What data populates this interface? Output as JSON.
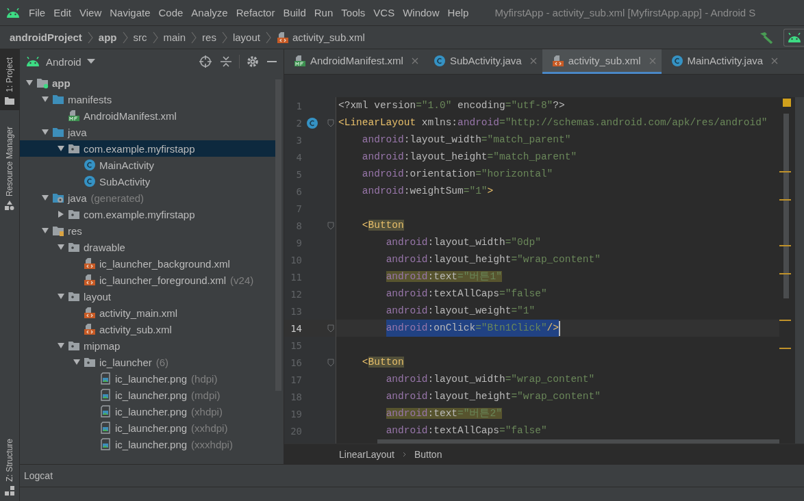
{
  "menu": [
    "File",
    "Edit",
    "View",
    "Navigate",
    "Code",
    "Analyze",
    "Refactor",
    "Build",
    "Run",
    "Tools",
    "VCS",
    "Window",
    "Help"
  ],
  "window": {
    "title": "MyfirstApp - activity_sub.xml [MyfirstApp.app] - Android S"
  },
  "breadcrumbs": [
    {
      "label": "androidProject",
      "bold": true,
      "kind": "dir"
    },
    {
      "label": "app",
      "bold": true,
      "kind": "dir"
    },
    {
      "label": "src",
      "bold": false,
      "kind": "dir"
    },
    {
      "label": "main",
      "bold": false,
      "kind": "dir"
    },
    {
      "label": "res",
      "bold": false,
      "kind": "dir"
    },
    {
      "label": "layout",
      "bold": false,
      "kind": "dir"
    },
    {
      "label": "activity_sub.xml",
      "bold": false,
      "kind": "file"
    }
  ],
  "left_strip": [
    {
      "label": "1: Project",
      "selected": true
    },
    {
      "label": "Resource Manager",
      "selected": false
    },
    {
      "label": "Z: Structure",
      "selected": false
    }
  ],
  "project_panel": {
    "view": "Android",
    "tree": [
      {
        "label": "app",
        "kind": "module",
        "bold": true,
        "expanded": true,
        "selected": false,
        "children": [
          {
            "label": "manifests",
            "kind": "folder",
            "bold": false,
            "expanded": true,
            "selected": false,
            "children": [
              {
                "label": "AndroidManifest.xml",
                "kind": "manifest",
                "bold": false,
                "selected": false
              }
            ]
          },
          {
            "label": "java",
            "kind": "folder",
            "bold": false,
            "expanded": true,
            "selected": false,
            "children": [
              {
                "label": "com.example.myfirstapp",
                "kind": "package",
                "bold": false,
                "expanded": true,
                "selected": true,
                "children": [
                  {
                    "label": "MainActivity",
                    "kind": "class",
                    "bold": false,
                    "selected": false
                  },
                  {
                    "label": "SubActivity",
                    "kind": "class",
                    "bold": false,
                    "selected": false
                  }
                ]
              }
            ]
          },
          {
            "label": "java",
            "note": "(generated)",
            "kind": "generated",
            "bold": false,
            "expanded": true,
            "selected": false,
            "children": [
              {
                "label": "com.example.myfirstapp",
                "kind": "package",
                "bold": false,
                "expanded": false,
                "selected": false
              }
            ]
          },
          {
            "label": "res",
            "kind": "res",
            "bold": false,
            "expanded": true,
            "selected": false,
            "children": [
              {
                "label": "drawable",
                "kind": "package",
                "bold": false,
                "expanded": true,
                "selected": false,
                "children": [
                  {
                    "label": "ic_launcher_background.xml",
                    "kind": "xml",
                    "bold": false,
                    "selected": false
                  },
                  {
                    "label": "ic_launcher_foreground.xml",
                    "note": "(v24)",
                    "kind": "xml",
                    "bold": false,
                    "selected": false
                  }
                ]
              },
              {
                "label": "layout",
                "kind": "package",
                "bold": false,
                "expanded": true,
                "selected": false,
                "children": [
                  {
                    "label": "activity_main.xml",
                    "kind": "xml",
                    "bold": false,
                    "selected": false
                  },
                  {
                    "label": "activity_sub.xml",
                    "kind": "xml",
                    "bold": false,
                    "selected": false
                  }
                ]
              },
              {
                "label": "mipmap",
                "kind": "package",
                "bold": false,
                "expanded": true,
                "selected": false,
                "children": [
                  {
                    "label": "ic_launcher",
                    "note": "(6)",
                    "kind": "package",
                    "bold": false,
                    "expanded": true,
                    "selected": false,
                    "children": [
                      {
                        "label": "ic_launcher.png",
                        "note": "(hdpi)",
                        "kind": "image",
                        "bold": false,
                        "selected": false
                      },
                      {
                        "label": "ic_launcher.png",
                        "note": "(mdpi)",
                        "kind": "image",
                        "bold": false,
                        "selected": false
                      },
                      {
                        "label": "ic_launcher.png",
                        "note": "(xhdpi)",
                        "kind": "image",
                        "bold": false,
                        "selected": false
                      },
                      {
                        "label": "ic_launcher.png",
                        "note": "(xxhdpi)",
                        "kind": "image",
                        "bold": false,
                        "selected": false
                      },
                      {
                        "label": "ic_launcher.png",
                        "note": "(xxxhdpi)",
                        "kind": "image",
                        "bold": false,
                        "selected": false
                      }
                    ]
                  }
                ]
              }
            ]
          }
        ]
      }
    ]
  },
  "tabs": [
    {
      "label": "AndroidManifest.xml",
      "kind": "manifest",
      "selected": false
    },
    {
      "label": "SubActivity.java",
      "kind": "class",
      "selected": false
    },
    {
      "label": "activity_sub.xml",
      "kind": "xml",
      "selected": true
    },
    {
      "label": "MainActivity.java",
      "kind": "class",
      "selected": false
    }
  ],
  "code": [
    {
      "number": "1",
      "current": false,
      "fold": false,
      "gutter_marker": false,
      "warning": false,
      "selected": false,
      "tokens": [
        {
          "text": "<?xml ",
          "kind": "plain"
        },
        {
          "text": "version",
          "kind": "attr"
        },
        {
          "text": "=\"1.0\" ",
          "kind": "value"
        },
        {
          "text": "encoding",
          "kind": "attr"
        },
        {
          "text": "=\"utf-8\"",
          "kind": "value"
        },
        {
          "text": "?>",
          "kind": "plain"
        }
      ]
    },
    {
      "number": "2",
      "current": false,
      "fold": true,
      "gutter_marker": true,
      "warning": false,
      "selected": false,
      "tokens": [
        {
          "text": "<LinearLayout ",
          "kind": "tag"
        },
        {
          "text": "xmlns:",
          "kind": "attr"
        },
        {
          "text": "android",
          "kind": "ns"
        },
        {
          "text": "=\"http://schemas.android.com/apk/res/android\"",
          "kind": "value"
        }
      ]
    },
    {
      "number": "3",
      "current": false,
      "fold": false,
      "gutter_marker": false,
      "warning": false,
      "selected": false,
      "tokens": [
        {
          "text": "    android",
          "kind": "ns"
        },
        {
          "text": ":layout_width",
          "kind": "attr"
        },
        {
          "text": "=\"match_parent\"",
          "kind": "value"
        }
      ]
    },
    {
      "number": "4",
      "current": false,
      "fold": false,
      "gutter_marker": false,
      "warning": false,
      "selected": false,
      "tokens": [
        {
          "text": "    android",
          "kind": "ns"
        },
        {
          "text": ":layout_height",
          "kind": "attr"
        },
        {
          "text": "=\"match_parent\"",
          "kind": "value"
        }
      ]
    },
    {
      "number": "5",
      "current": false,
      "fold": false,
      "gutter_marker": false,
      "warning": false,
      "selected": false,
      "tokens": [
        {
          "text": "    android",
          "kind": "ns"
        },
        {
          "text": ":orientation",
          "kind": "attr"
        },
        {
          "text": "=\"horizontal\"",
          "kind": "value"
        }
      ]
    },
    {
      "number": "6",
      "current": false,
      "fold": false,
      "gutter_marker": false,
      "warning": false,
      "selected": false,
      "tokens": [
        {
          "text": "    android",
          "kind": "ns"
        },
        {
          "text": ":weightSum",
          "kind": "attr"
        },
        {
          "text": "=\"1\"",
          "kind": "value"
        },
        {
          "text": ">",
          "kind": "tag"
        }
      ]
    },
    {
      "number": "7",
      "current": false,
      "fold": false,
      "gutter_marker": false
    },
    {
      "number": "8",
      "current": false,
      "fold": true,
      "gutter_marker": false,
      "warning": false,
      "selected": false,
      "tokens": [
        {
          "text": "    <",
          "kind": "tag"
        },
        {
          "text": "Button",
          "kind": "matched"
        }
      ]
    },
    {
      "number": "9",
      "current": false,
      "fold": false,
      "gutter_marker": false,
      "warning": false,
      "selected": false,
      "tokens": [
        {
          "text": "        android",
          "kind": "ns"
        },
        {
          "text": ":layout_width",
          "kind": "attr"
        },
        {
          "text": "=\"0dp\"",
          "kind": "value"
        }
      ]
    },
    {
      "number": "10",
      "current": false,
      "fold": false,
      "gutter_marker": false,
      "warning": false,
      "selected": false,
      "tokens": [
        {
          "text": "        android",
          "kind": "ns"
        },
        {
          "text": ":layout_height",
          "kind": "attr"
        },
        {
          "text": "=\"wrap_content\"",
          "kind": "value"
        }
      ]
    },
    {
      "number": "11",
      "current": false,
      "fold": false,
      "gutter_marker": false,
      "warning": true,
      "selected": false,
      "tokens": [
        {
          "text": "        android",
          "kind": "ns"
        },
        {
          "text": ":text",
          "kind": "attr"
        },
        {
          "text": "=\"버튼1\"",
          "kind": "value"
        }
      ]
    },
    {
      "number": "12",
      "current": false,
      "fold": false,
      "gutter_marker": false,
      "warning": false,
      "selected": false,
      "tokens": [
        {
          "text": "        android",
          "kind": "ns"
        },
        {
          "text": ":textAllCaps",
          "kind": "attr"
        },
        {
          "text": "=\"false\"",
          "kind": "value"
        }
      ]
    },
    {
      "number": "13",
      "current": false,
      "fold": false,
      "gutter_marker": false,
      "warning": false,
      "selected": false,
      "tokens": [
        {
          "text": "        android",
          "kind": "ns"
        },
        {
          "text": ":layout_weight",
          "kind": "attr"
        },
        {
          "text": "=\"1\"",
          "kind": "value"
        }
      ]
    },
    {
      "number": "14",
      "current": true,
      "fold": true,
      "gutter_marker": false,
      "warning": false,
      "selected": true,
      "tokens": [
        {
          "text": "        android",
          "kind": "ns"
        },
        {
          "text": ":onClick",
          "kind": "attr"
        },
        {
          "text": "=\"Btn1Click\"",
          "kind": "value"
        },
        {
          "text": "/>",
          "kind": "tag"
        }
      ]
    },
    {
      "number": "15",
      "current": false,
      "fold": false,
      "gutter_marker": false
    },
    {
      "number": "16",
      "current": false,
      "fold": true,
      "gutter_marker": false,
      "warning": false,
      "selected": false,
      "tokens": [
        {
          "text": "    <",
          "kind": "tag"
        },
        {
          "text": "Button",
          "kind": "matched"
        }
      ]
    },
    {
      "number": "17",
      "current": false,
      "fold": false,
      "gutter_marker": false,
      "warning": false,
      "selected": false,
      "tokens": [
        {
          "text": "        android",
          "kind": "ns"
        },
        {
          "text": ":layout_width",
          "kind": "attr"
        },
        {
          "text": "=\"wrap_content\"",
          "kind": "value"
        }
      ]
    },
    {
      "number": "18",
      "current": false,
      "fold": false,
      "gutter_marker": false,
      "warning": false,
      "selected": false,
      "tokens": [
        {
          "text": "        android",
          "kind": "ns"
        },
        {
          "text": ":layout_height",
          "kind": "attr"
        },
        {
          "text": "=\"wrap_content\"",
          "kind": "value"
        }
      ]
    },
    {
      "number": "19",
      "current": false,
      "fold": false,
      "gutter_marker": false,
      "warning": true,
      "selected": false,
      "tokens": [
        {
          "text": "        android",
          "kind": "ns"
        },
        {
          "text": ":text",
          "kind": "attr"
        },
        {
          "text": "=\"버튼2\"",
          "kind": "value"
        }
      ]
    },
    {
      "number": "20",
      "current": false,
      "fold": false,
      "gutter_marker": false,
      "warning": false,
      "selected": false,
      "tokens": [
        {
          "text": "        android",
          "kind": "ns"
        },
        {
          "text": ":textAllCaps",
          "kind": "attr"
        },
        {
          "text": "=\"false\"",
          "kind": "value"
        }
      ]
    }
  ],
  "editor_breadcrumbs": [
    "LinearLayout",
    "Button"
  ],
  "bottom_panel": {
    "label": "Logcat"
  }
}
